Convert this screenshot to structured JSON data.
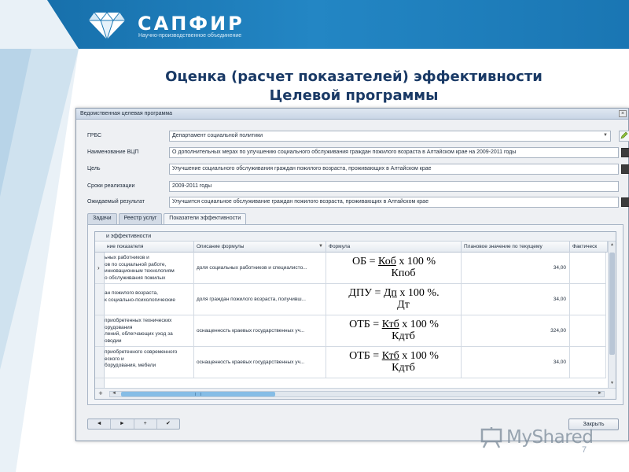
{
  "slide": {
    "brand": "САПФИР",
    "brand_sub": "Научно-производственное объединение",
    "title_line1": "Оценка (расчет показателей) эффективности",
    "title_line2": "Целевой программы",
    "page_number": "7",
    "watermark": "MyShared",
    "colors": {
      "header": "#1b78b4",
      "title": "#1a3a66",
      "scroll_thumb": "#86bde6"
    }
  },
  "window": {
    "title": "Ведомственная целевая программа",
    "close_glyph": "×",
    "fields": [
      {
        "label": "ГРБС",
        "value": "Департамент социальной политики",
        "control": "dropdown"
      },
      {
        "label": "Наименование ВЦП",
        "value": "О дополнительных мерах по улучшению социального обслуживания граждан пожилого возраста в Алтайском крае на 2009-2011 годы",
        "control": "button"
      },
      {
        "label": "Цель",
        "value": "Улучшение социального обслуживания граждан пожилого возраста, проживающих в Алтайском крае",
        "control": "button"
      },
      {
        "label": "Сроки реализации",
        "value": "2009-2011 годы",
        "control": "none"
      },
      {
        "label": "Ожидаемый результат",
        "value": "Улучшится социальное обслуживание граждан пожилого возраста, проживающих в Алтайском крае",
        "control": "button"
      }
    ],
    "tabs": [
      {
        "label": "Задачи",
        "active": false
      },
      {
        "label": "Реестр услуг",
        "active": false
      },
      {
        "label": "Показатели эффективности",
        "active": true
      }
    ],
    "grid": {
      "caption": "и эффективности",
      "columns": [
        "ние показателя",
        "Описание формулы",
        "Формула",
        "Плановое значение по текущему",
        "Фактическ"
      ],
      "rows": [
        {
          "name": [
            "ьных работников и",
            "ов по социальной работе,",
            "инновационным технологиям",
            "о обслуживания пожилых"
          ],
          "description": "доля социальных работников и специалисто...",
          "formula_lhs": "ОБ = ",
          "formula_num": "Коб",
          "formula_tail": " х 100 %",
          "formula_den": "Кпоб",
          "plan": "34,00",
          "current": true
        },
        {
          "name": [
            "ан пожилого возраста,",
            "к социально-психологические"
          ],
          "description": "доля граждан пожилого возраста, получивш...",
          "formula_lhs": "ДПУ = ",
          "formula_num": "Дп",
          "formula_tail": " х 100 %.",
          "formula_den": "Дт",
          "plan": "34,00",
          "current": false
        },
        {
          "name": [
            "приобретенных технических",
            "орудования",
            "лений, облегчающих уход за",
            "оводии"
          ],
          "description": "оснащенность краевых государственных уч...",
          "formula_lhs": "ОТБ = ",
          "formula_num": "Ктб",
          "formula_tail": " х 100 %",
          "formula_den": "Кдтб",
          "plan": "324,00",
          "current": false
        },
        {
          "name": [
            "приобретенного современного",
            "еского и",
            "борудования, мебели"
          ],
          "description": "оснащенность краевых государственных уч...",
          "formula_lhs": "ОТБ = ",
          "formula_num": "Ктб",
          "formula_tail": " х 100 %",
          "formula_den": "Кдтб",
          "plan": "34,00",
          "current": false
        }
      ],
      "add_glyph": "+"
    },
    "navigator": [
      "◄",
      "►",
      "+",
      "✔"
    ],
    "close_label": "Закрыть"
  }
}
